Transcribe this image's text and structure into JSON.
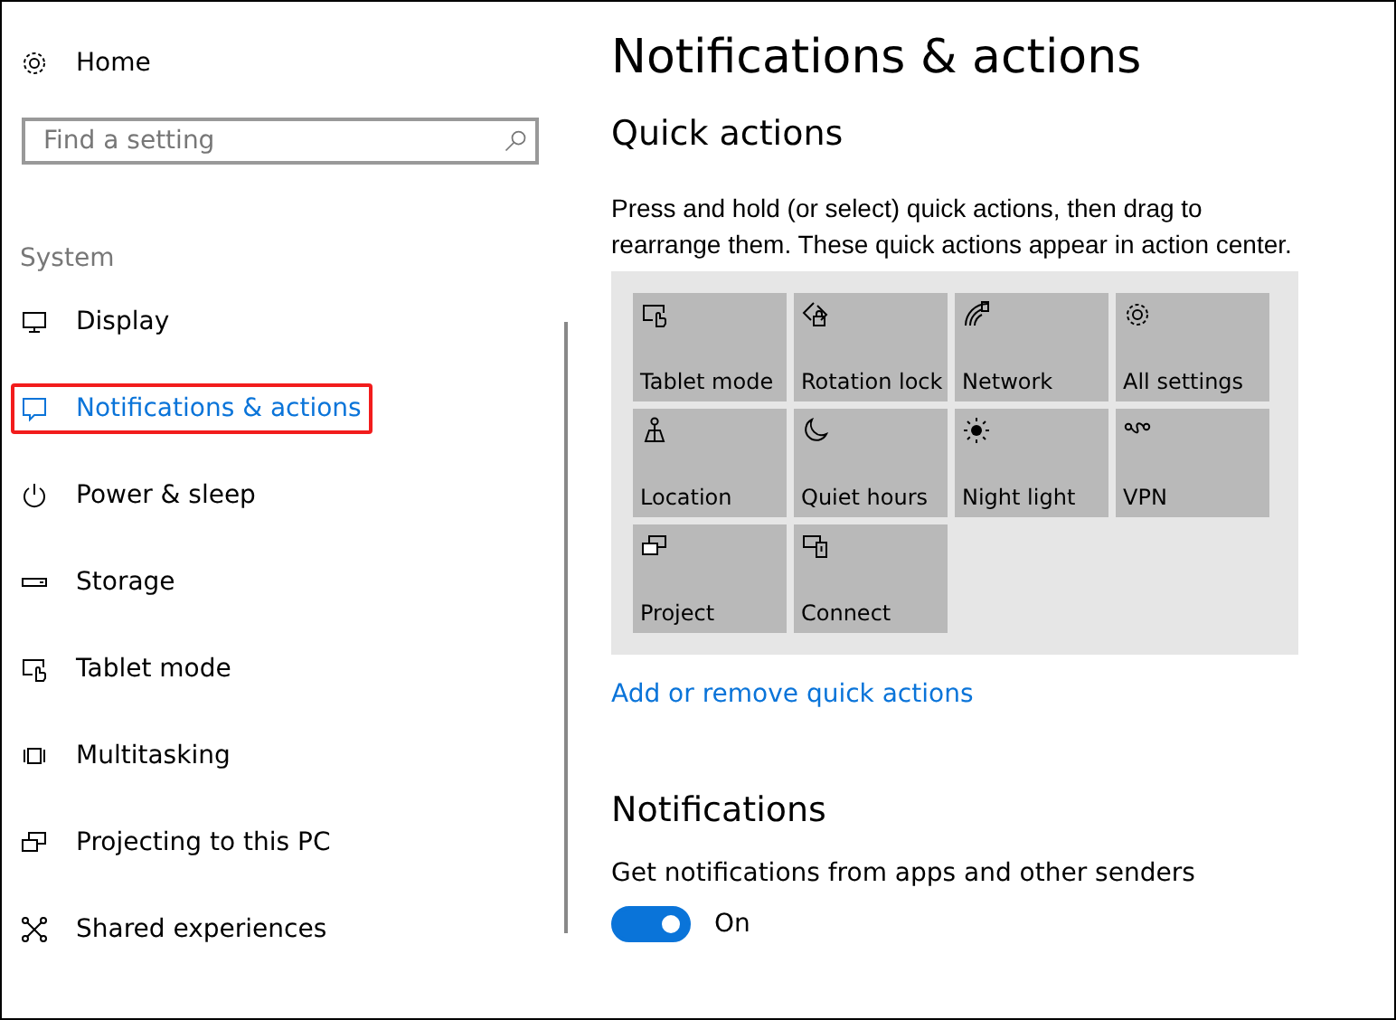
{
  "sidebar": {
    "home": "Home",
    "search": {
      "placeholder": "Find a setting"
    },
    "section": "System",
    "items": [
      {
        "label": "Display",
        "selected": false,
        "highlighted": false
      },
      {
        "label": "Notifications & actions",
        "selected": true,
        "highlighted": true
      },
      {
        "label": "Power & sleep",
        "selected": false,
        "highlighted": false
      },
      {
        "label": "Storage",
        "selected": false,
        "highlighted": false
      },
      {
        "label": "Tablet mode",
        "selected": false,
        "highlighted": false
      },
      {
        "label": "Multitasking",
        "selected": false,
        "highlighted": false
      },
      {
        "label": "Projecting to this PC",
        "selected": false,
        "highlighted": false
      },
      {
        "label": "Shared experiences",
        "selected": false,
        "highlighted": false
      }
    ]
  },
  "page_title": "Notifications & actions",
  "quick_actions": {
    "heading": "Quick actions",
    "description": "Press and hold (or select) quick actions, then drag to rearrange them. These quick actions appear in action center.",
    "tiles": [
      "Tablet mode",
      "Rotation lock",
      "Network",
      "All settings",
      "Location",
      "Quiet hours",
      "Night light",
      "VPN",
      "Project",
      "Connect"
    ],
    "link": "Add or remove quick actions"
  },
  "notifications": {
    "heading": "Notifications",
    "setting": "Get notifications from apps and other senders",
    "toggle": {
      "on": true,
      "label": "On"
    }
  }
}
